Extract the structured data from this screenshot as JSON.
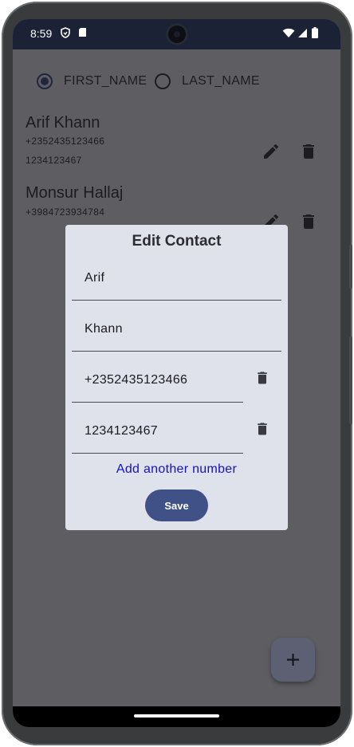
{
  "status_bar": {
    "time": "8:59",
    "icons": [
      "shield-icon",
      "sd-card-icon",
      "wifi-icon",
      "signal-icon",
      "battery-icon"
    ]
  },
  "sort_options": [
    {
      "label": "FIRST_NAME",
      "selected": true
    },
    {
      "label": "LAST_NAME",
      "selected": false
    }
  ],
  "contacts": [
    {
      "name": "Arif Khann",
      "phones": [
        "+2352435123466",
        "1234123467"
      ]
    },
    {
      "name": "Monsur Hallaj",
      "phones": [
        "+3984723934784"
      ]
    }
  ],
  "dialog": {
    "title": "Edit Contact",
    "first_name": "Arif",
    "last_name": "Khann",
    "phones": [
      "+2352435123466",
      "1234123467"
    ],
    "add_number_label": "Add another number",
    "save_label": "Save"
  },
  "fab": {
    "icon": "plus-icon"
  },
  "colors": {
    "scrim": "#5e5e62",
    "dialog_bg": "#dfe1eb",
    "accent": "#3f5186",
    "link": "#1512c4",
    "status_bar": "#1b2236"
  }
}
